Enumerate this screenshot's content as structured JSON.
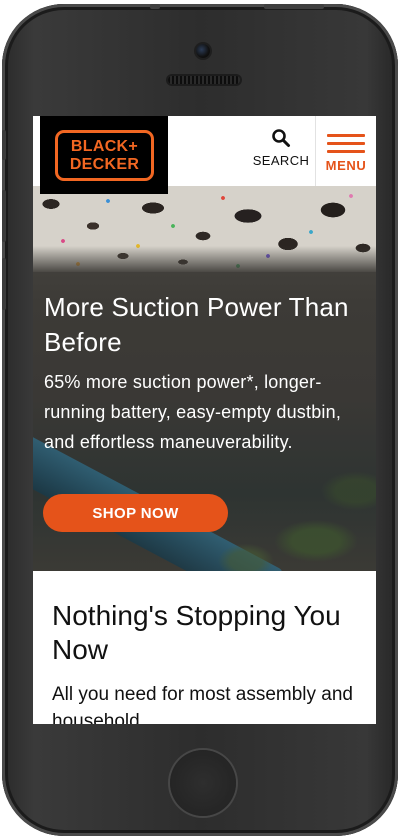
{
  "header": {
    "logo": {
      "line1": "BLACK+",
      "line2": "DECKER"
    },
    "search_label": "SEARCH",
    "menu_label": "MENU"
  },
  "hero": {
    "title": "More Suction Power Than Before",
    "description": "65% more suction power*, longer-running battery, easy-empty dustbin, and effortless maneuverability.",
    "cta_label": "SHOP NOW"
  },
  "promo": {
    "title": "Nothing's Stopping You Now",
    "description": "All you need for most assembly and household"
  },
  "colors": {
    "brand_orange": "#e5531a",
    "logo_orange": "#f26722"
  }
}
